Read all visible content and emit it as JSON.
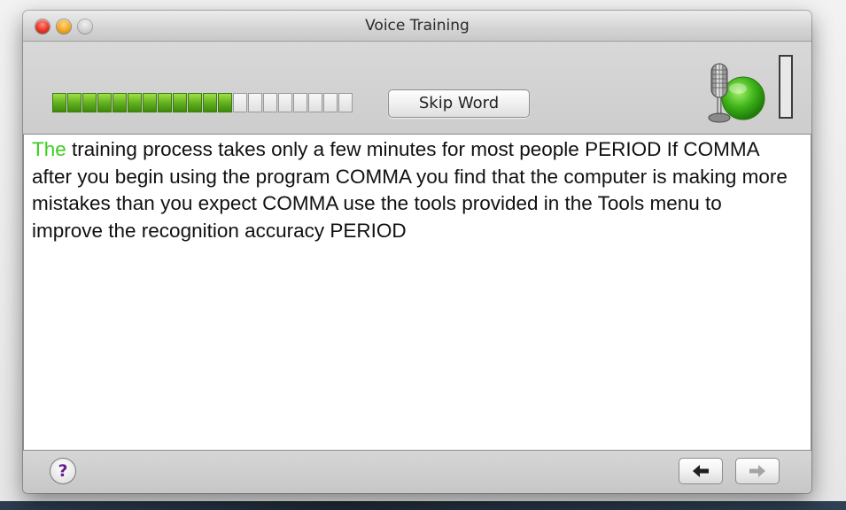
{
  "window": {
    "title": "Voice Training"
  },
  "progress": {
    "total_segments": 20,
    "filled_segments": 12,
    "fraction": 0.6
  },
  "toolbar": {
    "skip_label": "Skip Word"
  },
  "training_text": {
    "highlighted_word": "The",
    "remaining_text": " training process takes only a few minutes for most people PERIOD If COMMA after you begin using the program COMMA you find that the computer is making more mistakes than you expect COMMA use the tools provided in the Tools menu to improve the recognition accuracy PERIOD"
  },
  "footer": {
    "help_label": "?",
    "back_glyph": "🡐",
    "forward_glyph": "🡒"
  },
  "icons": {
    "microphone": "microphone-icon",
    "status": "green-status-indicator"
  },
  "colors": {
    "highlight": "#3ccd1e",
    "progress_fill": "#5fae1c",
    "status_green": "#3fb51a"
  }
}
